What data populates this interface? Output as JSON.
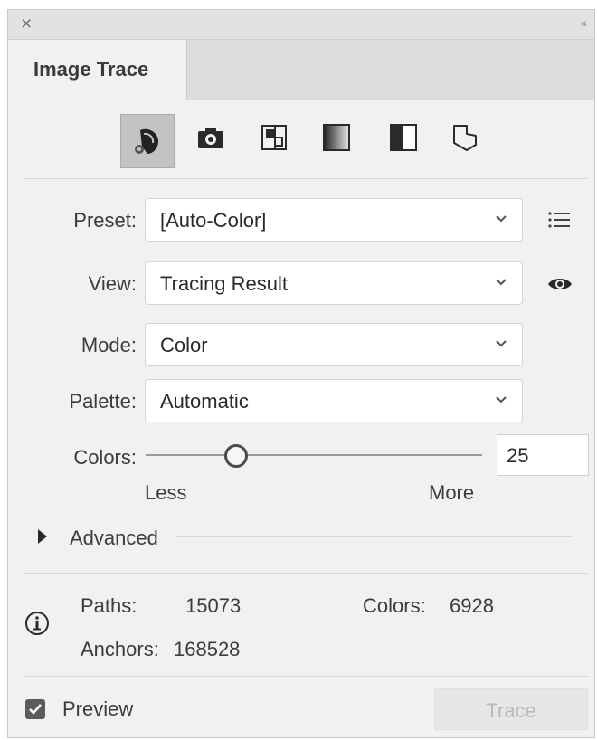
{
  "window": {
    "close_glyph": "×",
    "collapse_glyph": "‹‹"
  },
  "tabs": [
    {
      "label": "Image Trace"
    }
  ],
  "presets_bar": {
    "icons": [
      "auto-color-icon",
      "high-color-icon",
      "low-color-icon",
      "grayscale-icon",
      "black-and-white-icon",
      "outline-icon"
    ],
    "active_index": 0
  },
  "preset": {
    "label": "Preset:",
    "value": "[Auto-Color]"
  },
  "view": {
    "label": "View:",
    "value": "Tracing Result"
  },
  "mode": {
    "label": "Mode:",
    "value": "Color"
  },
  "palette": {
    "label": "Palette:",
    "value": "Automatic"
  },
  "colors_slider": {
    "label": "Colors:",
    "value": "25",
    "fraction": 0.25,
    "min_label": "Less",
    "max_label": "More"
  },
  "advanced": {
    "label": "Advanced"
  },
  "stats": {
    "paths_label": "Paths:",
    "paths_value": "15073",
    "colors_label": "Colors:",
    "colors_value": "6928",
    "anchors_label": "Anchors:",
    "anchors_value": "168528"
  },
  "preview": {
    "label": "Preview",
    "checked": true
  },
  "trace_button": {
    "label": "Trace",
    "enabled": false
  },
  "colors": {
    "panel_bg": "#f1f1f1",
    "active_icon_bg": "#c3c3c3",
    "checkbox": "#5b5b5b"
  }
}
